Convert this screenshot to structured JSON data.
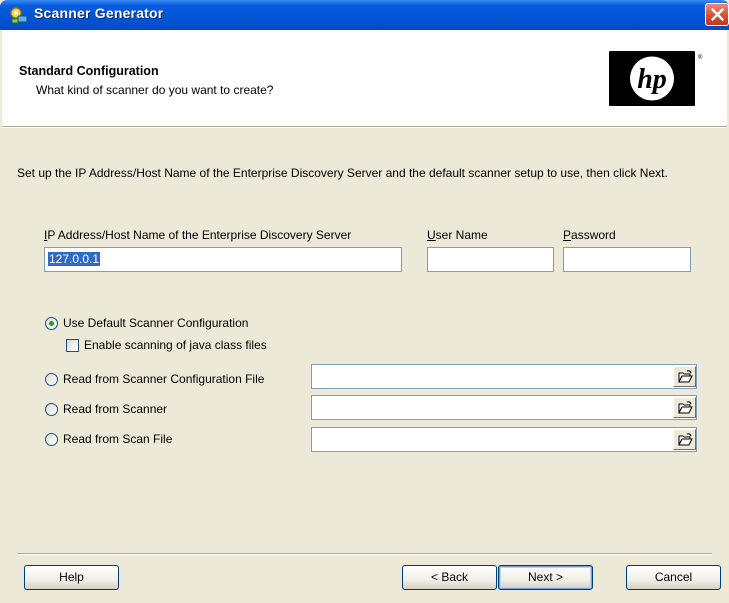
{
  "window": {
    "title": "Scanner Generator",
    "icon": "scanner-generator-icon",
    "close_icon": "close-icon"
  },
  "header": {
    "title": "Standard Configuration",
    "subtitle": "What kind of scanner do you want to create?",
    "logo": "hp",
    "logo_mark": "®"
  },
  "intro_text": "Set up the IP Address/Host Name of the Enterprise Discovery Server and the default scanner setup to use, then click Next.",
  "server": {
    "ip_label_accel": "I",
    "ip_label_rest": "P Address/Host Name of the Enterprise Discovery Server",
    "ip_value": "127.0.0.1",
    "user_label_accel": "U",
    "user_label_rest": "ser Name",
    "user_value": "",
    "password_label_accel": "P",
    "password_label_rest": "assword",
    "password_value": ""
  },
  "options": {
    "selected": "default",
    "default_label": "Use Default Scanner Configuration",
    "java_label": "Enable scanning of java class files",
    "java_checked": false,
    "config_file_label": "Read from Scanner Configuration File",
    "config_file_value": "",
    "scanner_label": "Read from Scanner",
    "scanner_value": "",
    "scan_file_label": "Read from Scan File",
    "scan_file_value": "",
    "browse_icon": "open-folder-icon"
  },
  "buttons": {
    "help": "Help",
    "back": "< Back",
    "next": "Next >",
    "cancel": "Cancel"
  },
  "colors": {
    "titlebar": "#0456d8",
    "dialog_bg": "#ece9d8",
    "selection": "#316ac5",
    "radio_dot": "#21a121"
  }
}
